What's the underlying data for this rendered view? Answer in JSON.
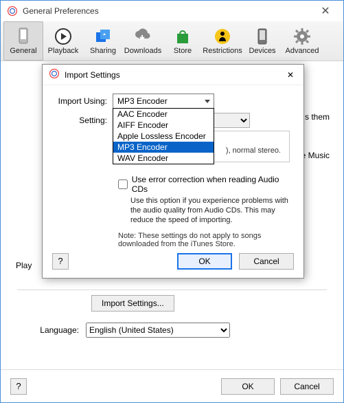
{
  "window": {
    "title": "General Preferences"
  },
  "toolbar": {
    "items": [
      {
        "label": "General"
      },
      {
        "label": "Playback"
      },
      {
        "label": "Sharing"
      },
      {
        "label": "Downloads"
      },
      {
        "label": "Store"
      },
      {
        "label": "Restrictions"
      },
      {
        "label": "Devices"
      },
      {
        "label": "Advanced"
      }
    ]
  },
  "background": {
    "peek_text_right1": "s them",
    "peek_text_right2": "e Music",
    "play_label_fragment": "Play",
    "import_settings_button": "Import Settings...",
    "language_label": "Language:",
    "language_value": "English (United States)",
    "help_label": "?",
    "ok_label": "OK",
    "cancel_label": "Cancel"
  },
  "modal": {
    "title": "Import Settings",
    "import_using_label": "Import Using:",
    "import_using_value": "MP3 Encoder",
    "encoder_options": [
      "AAC Encoder",
      "AIFF Encoder",
      "Apple Lossless Encoder",
      "MP3 Encoder",
      "WAV Encoder"
    ],
    "setting_label": "Setting:",
    "details_fragment": "), normal stereo.",
    "error_correction_label": "Use error correction when reading Audio CDs",
    "error_correction_hint": "Use this option if you experience problems with the audio quality from Audio CDs.  This may reduce the speed of importing.",
    "note": "Note: These settings do not apply to songs downloaded from the iTunes Store.",
    "help_label": "?",
    "ok_label": "OK",
    "cancel_label": "Cancel"
  }
}
